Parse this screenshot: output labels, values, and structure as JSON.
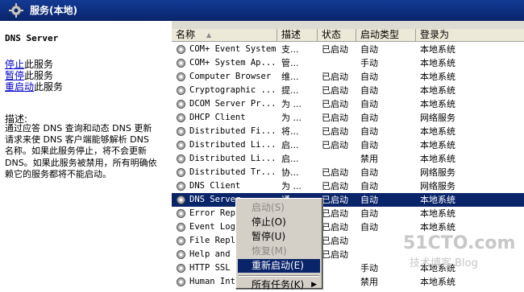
{
  "header": {
    "title": "服务(本地)"
  },
  "left": {
    "service_name": "DNS Server",
    "actions": [
      {
        "link": "停止",
        "suffix": "此服务"
      },
      {
        "link": "暂停",
        "suffix": "此服务"
      },
      {
        "link": "重启动",
        "suffix": "此服务"
      }
    ],
    "desc_label": "描述:",
    "desc_lines": [
      "通过应答 DNS 查询和动态 DNS 更新",
      "请求来使 DNS 客户端能够解析 DNS",
      "名称。如果此服务停止，将不会更新",
      "DNS。如果此服务被禁用，所有明确依",
      "赖它的服务都将不能启动。"
    ]
  },
  "columns": {
    "name": "名称",
    "sort": "▲",
    "desc": "描述",
    "status": "状态",
    "startup": "启动类型",
    "logon": "登录为"
  },
  "rows": [
    {
      "name": "COM+ Event System",
      "desc": "支...",
      "status": "已启动",
      "startup": "自动",
      "logon": "本地系统"
    },
    {
      "name": "COM+ System Ap...",
      "desc": "管...",
      "status": "",
      "startup": "手动",
      "logon": "本地系统"
    },
    {
      "name": "Computer Browser",
      "desc": "维...",
      "status": "已启动",
      "startup": "自动",
      "logon": "本地系统"
    },
    {
      "name": "Cryptographic ...",
      "desc": "提...",
      "status": "已启动",
      "startup": "自动",
      "logon": "本地系统"
    },
    {
      "name": "DCOM Server Pr...",
      "desc": "为 ...",
      "status": "已启动",
      "startup": "自动",
      "logon": "本地系统"
    },
    {
      "name": "DHCP Client",
      "desc": "为 ...",
      "status": "已启动",
      "startup": "自动",
      "logon": "网络服务"
    },
    {
      "name": "Distributed Fi...",
      "desc": "将...",
      "status": "已启动",
      "startup": "自动",
      "logon": "本地系统"
    },
    {
      "name": "Distributed Li...",
      "desc": "启...",
      "status": "已启动",
      "startup": "自动",
      "logon": "本地系统"
    },
    {
      "name": "Distributed Li...",
      "desc": "启...",
      "status": "",
      "startup": "禁用",
      "logon": "本地系统"
    },
    {
      "name": "Distributed Tr...",
      "desc": "协...",
      "status": "已启动",
      "startup": "自动",
      "logon": "网络服务"
    },
    {
      "name": "DNS Client",
      "desc": "为 ...",
      "status": "已启动",
      "startup": "自动",
      "logon": "网络服务"
    },
    {
      "name": "DNS Server",
      "desc": "通",
      "status": "已启动",
      "startup": "自动",
      "logon": "本地系统",
      "selected": true
    },
    {
      "name": "Error Rep",
      "desc": "",
      "status": "已启动",
      "startup": "自动",
      "logon": "本地系统"
    },
    {
      "name": "Event Log",
      "desc": "",
      "status": "已启动",
      "startup": "自动",
      "logon": "本地系统"
    },
    {
      "name": "File Repl",
      "desc": "",
      "status": "已启动",
      "startup": "",
      "logon": ""
    },
    {
      "name": "Help and S",
      "desc": "",
      "status": "已启动",
      "startup": "",
      "logon": ""
    },
    {
      "name": "HTTP SSL",
      "desc": "",
      "status": "",
      "startup": "手动",
      "logon": "本地系统"
    },
    {
      "name": "Human Inte",
      "desc": "",
      "status": "",
      "startup": "禁用",
      "logon": "本地系统"
    }
  ],
  "context_menu": {
    "items": [
      {
        "label": "启动(S)",
        "disabled": true
      },
      {
        "label": "停止(O)"
      },
      {
        "label": "暂停(U)"
      },
      {
        "label": "恢复(M)",
        "disabled": true
      },
      {
        "label": "重新启动(E)",
        "highlighted": true
      },
      {
        "label": "所有任务(K)",
        "submenu": "▶"
      }
    ]
  },
  "watermark": {
    "line1": "51CTO.com",
    "line2": "技术博客 Blog"
  },
  "colors": {
    "header_bg": "#0a246a",
    "selection": "#0a246a",
    "menu_bg": "#d4d0c8",
    "link": "#0000cc"
  }
}
